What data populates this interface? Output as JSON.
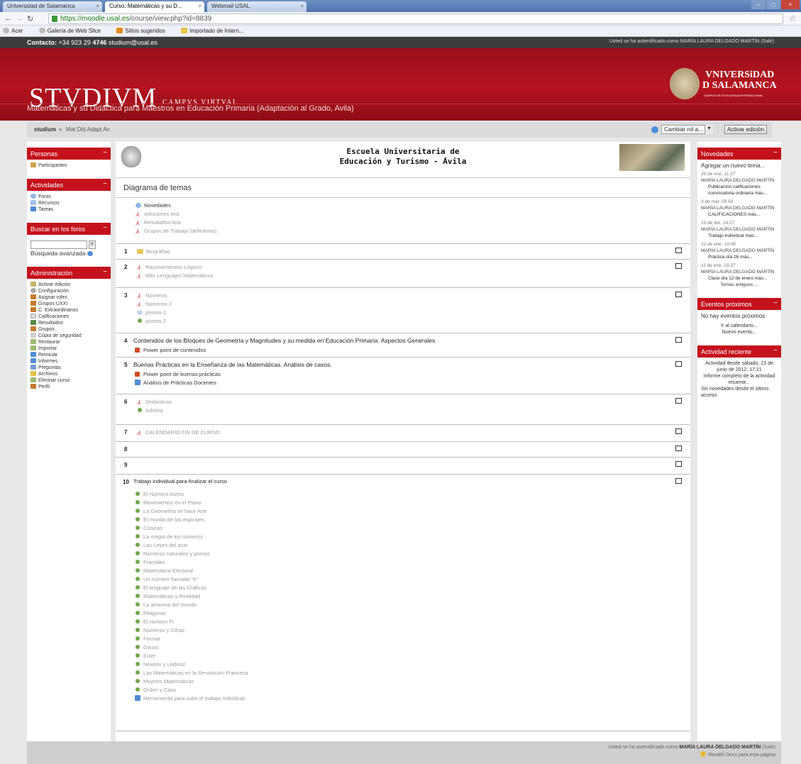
{
  "browser": {
    "tabs": [
      {
        "label": "Universidad de Salamanca"
      },
      {
        "label": "Curso: Matemáticas y su D..."
      },
      {
        "label": "Webmail USAL"
      }
    ],
    "url_host": "https://moodle.usal.es",
    "url_path": "/course/view.php?id=8839",
    "bookmarks": [
      "Acer",
      "Galería de Web Slice",
      "Sitios sugeridos",
      "Importado de Intern..."
    ]
  },
  "topbar": {
    "contact_label": "Contacto:",
    "phone_prefix": "+34 923 29",
    "phone_ext": "4746",
    "email": "studium@usal.es",
    "auth_text": "Usted se ha autentificado como",
    "user": "MARÍA LAURA DELGADO MARTÍN",
    "logout": "(Salir)"
  },
  "banner": {
    "logo": "STVDIVM",
    "logo_sub": "CAMPVS VIRTVAL",
    "univ1": "VNIVERSiDAD",
    "univ2": "D SALAMANCA",
    "univ3": "CAMPUS DE EXCELENCIA INTERNACIONAL",
    "course_title": "Matemáticas y su Didáctica para Maestros en Educación Primaria (Adaptación al Grado, Avila)"
  },
  "breadcrumb": {
    "home": "studium",
    "course": "Mat Did Adapt Av"
  },
  "role": {
    "select": "Cambiar rol a...",
    "edit_button": "Activar edición"
  },
  "left": {
    "personas": {
      "title": "Personas",
      "items": [
        "Participantes"
      ]
    },
    "actividades": {
      "title": "Actividades",
      "items": [
        "Foros",
        "Recursos",
        "Tareas"
      ]
    },
    "buscar": {
      "title": "Buscar en los foros",
      "go": "Ir",
      "advanced": "Búsqueda avanzada"
    },
    "admin": {
      "title": "Administración",
      "items": [
        "Activar edición",
        "Configuración",
        "Asignar roles",
        "Grupos UXXI",
        "C. Extraordinarios",
        "Calificaciones",
        "Resultados",
        "Grupos",
        "Copia de seguridad",
        "Restaurar",
        "Importar",
        "Reiniciar",
        "Informes",
        "Preguntas",
        "Archivos",
        "Eliminar curso",
        "Perfil"
      ]
    }
  },
  "main": {
    "school_line1": "Escuela Universitaria de",
    "school_line2": "Educación y Turismo - Ávila",
    "diagram_title": "Diagrama de temas",
    "s0": [
      "Novedades",
      "soluciones test",
      "Resultados test",
      "Grupos de Trabajo (definitivos)"
    ],
    "s1": [
      "Biografías"
    ],
    "s2": [
      "Razonamientos Lógicos",
      "Más Lenguajes Matemáticos"
    ],
    "s3": [
      "Números",
      "Números-2",
      "primos-1",
      "primos-2"
    ],
    "s4_title": "Contenidos de los Bloques de Geometría y Magnitudes y su medida en Educación Primaria. Aspectos Generales",
    "s4": [
      "Power point de contenidos"
    ],
    "s5_title": "Buenas Prácticas en la Enseñanza de las Matemáticas. Análisis de casos.",
    "s5": [
      "Power point de buenas prácticas",
      "Análisis de Prácticas Docentes"
    ],
    "s6": [
      "Diofánticas",
      "Adivina"
    ],
    "s7": [
      "CALENDARIO FIN DE CURSO"
    ],
    "s10_title": "Trabajo individual para finalizar el curso",
    "s10": [
      "El Número Aureo",
      "Movimientos en el Plano",
      "La Geometría se hace Arte",
      "El mundo de las espirales",
      "Cónicas",
      "La magia de los números",
      "Las Leyes del azar",
      "Números naturales y primos",
      "Fractales",
      "Matemática Electoral",
      "Un número llamado \"e\"",
      "El lenguaje de las Gráficas",
      "Matemáticas y Realidad",
      "La armonía del mundo",
      "Pitágoras",
      "El número Pi",
      "Números y Cifras",
      "Fermat",
      "Gauss",
      "Euler",
      "Newton y Leibnitz",
      "Las Matemáticas en la Revolución Francesa",
      "Mujeres Matemáticas",
      "Orden y Caos",
      "Herramienta para subir el trabajo individual"
    ]
  },
  "right": {
    "novedades": {
      "title": "Novedades",
      "add": "Agregar un nuevo tema...",
      "posts": [
        {
          "date": "20 de mar, 11:27",
          "who": "MARÍA LAURA DELGADO MARTÍN",
          "msg": "Publicación calificaciones convocatoria ordinaria más..."
        },
        {
          "date": "9 de mar, 09:50",
          "who": "MARÍA LAURA DELGADO MARTÍN",
          "msg": "CALIFICACIONES más..."
        },
        {
          "date": "10 de feb, 14:27",
          "who": "MARÍA LAURA DELGADO MARTÍN",
          "msg": "Trabajo individual más..."
        },
        {
          "date": "12 de ene, 19:08",
          "who": "MARÍA LAURA DELGADO MARTÍN",
          "msg": "Práctica día 26 más..."
        },
        {
          "date": "11 de ene, 23:37",
          "who": "MARÍA LAURA DELGADO MARTÍN",
          "msg": "Clase día 12 de enero más..."
        }
      ],
      "older": "Temas antiguos ..."
    },
    "eventos": {
      "title": "Eventos próximos",
      "none": "No hay eventos próximos",
      "cal": "Ir al calendario...",
      "new": "Nuevo evento..."
    },
    "actividad": {
      "title": "Actividad reciente",
      "since": "Actividad desde sábado, 23 de junio de 2012, 17:21",
      "report": "Informe completo de la actividad reciente...",
      "none": "Sin novedades desde el último acceso"
    }
  },
  "footer": {
    "auth": "Usted se ha autentificado como",
    "user": "MARÍA LAURA DELGADO MARTÍN",
    "logout": "(Salir)",
    "docs": "Moodle Docs para esta página"
  }
}
